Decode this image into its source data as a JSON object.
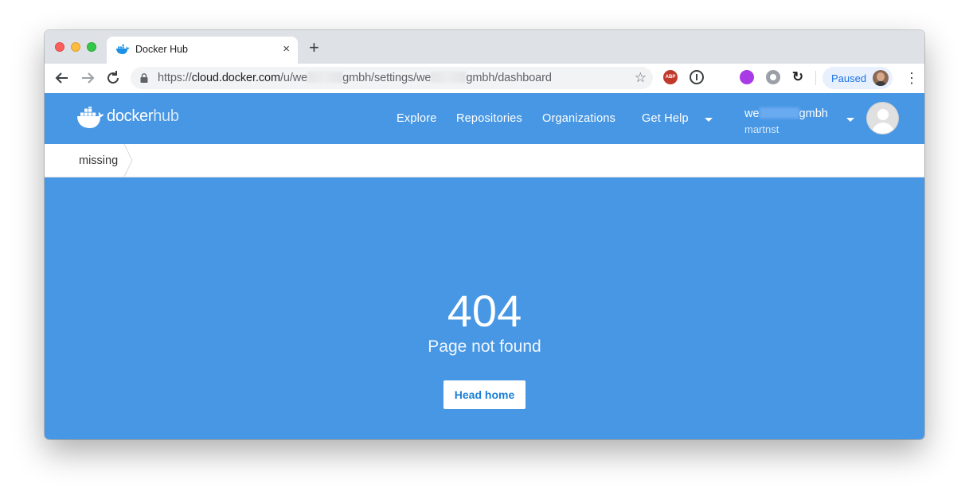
{
  "browser": {
    "tab": {
      "title": "Docker Hub",
      "close_icon": "×"
    },
    "new_tab_icon": "+",
    "url": {
      "scheme": "https://",
      "host": "cloud.docker.com",
      "path_1": "/u/we",
      "path_2": "gmbh/settings/we",
      "path_3": "gmbh/dashboard"
    },
    "star_icon": "☆",
    "extensions": {
      "abp_label": "ABP",
      "sync_icon": "↻"
    },
    "profile": {
      "label": "Paused"
    },
    "menu_icon": "⋮"
  },
  "header": {
    "logo": {
      "docker": "docker",
      "hub": "hub"
    },
    "nav": {
      "explore": "Explore",
      "repositories": "Repositories",
      "organizations": "Organizations",
      "get_help": "Get Help"
    },
    "account": {
      "org_prefix": "we",
      "org_suffix": "gmbh",
      "username": "martnst"
    }
  },
  "breadcrumb": {
    "current": "missing"
  },
  "error": {
    "code": "404",
    "message": "Page not found",
    "button_label": "Head home"
  },
  "colors": {
    "brand_blue": "#4797e4",
    "button_text": "#1c7ed6",
    "chrome_bg": "#dee1e6"
  }
}
